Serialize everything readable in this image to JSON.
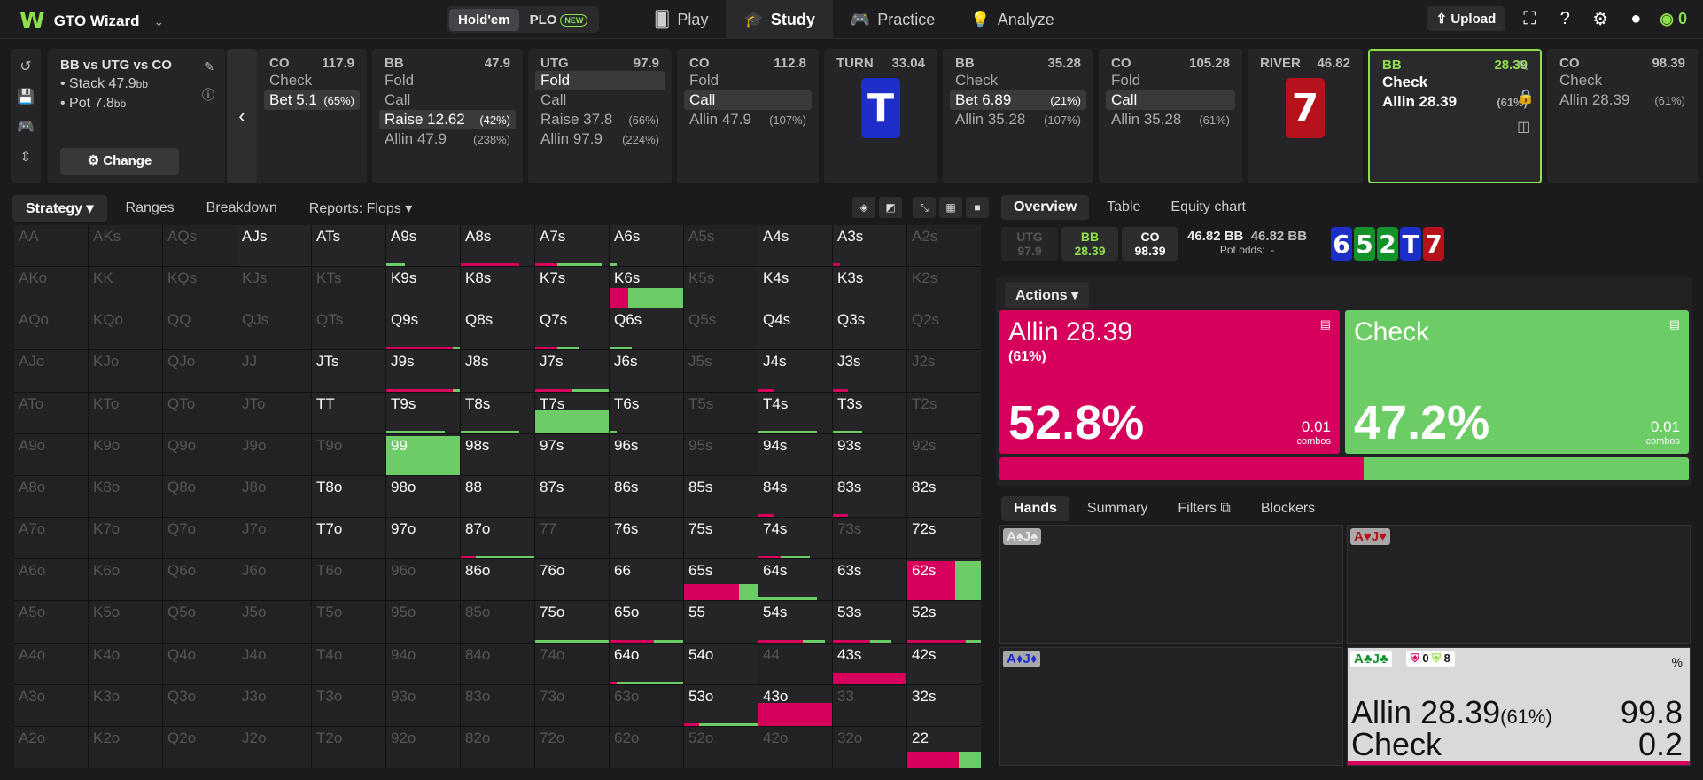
{
  "app": {
    "name": "GTO Wizard"
  },
  "game_toggle": {
    "holdem": "Hold'em",
    "plo": "PLO",
    "plo_badge": "NEW"
  },
  "nav": {
    "play": "Play",
    "study": "Study",
    "practice": "Practice",
    "analyze": "Analyze"
  },
  "topright": {
    "upload": "Upload",
    "credits": "0"
  },
  "spot": {
    "title": "BB vs UTG vs CO",
    "stack_label": "Stack",
    "stack": "47.9",
    "pot_label": "Pot",
    "pot": "7.8",
    "unit": "bb",
    "change": "Change"
  },
  "cards": [
    {
      "pos": "CO",
      "val": "117.9",
      "rows": [
        {
          "a": "Check",
          "p": ""
        },
        {
          "a": "Bet 5.1",
          "p": "(65%)",
          "sel": true
        }
      ]
    },
    {
      "pos": "BB",
      "val": "47.9",
      "rows": [
        {
          "a": "Fold",
          "p": ""
        },
        {
          "a": "Call",
          "p": ""
        },
        {
          "a": "Raise 12.62",
          "p": "(42%)",
          "sel": true
        },
        {
          "a": "Allin 47.9",
          "p": "(238%)"
        }
      ]
    },
    {
      "pos": "UTG",
      "val": "97.9",
      "rows": [
        {
          "a": "Fold",
          "p": "",
          "sel": true
        },
        {
          "a": "Call",
          "p": ""
        },
        {
          "a": "Raise 37.8",
          "p": "(66%)"
        },
        {
          "a": "Allin 97.9",
          "p": "(224%)"
        }
      ]
    },
    {
      "pos": "CO",
      "val": "112.8",
      "rows": [
        {
          "a": "Fold",
          "p": ""
        },
        {
          "a": "Call",
          "p": "",
          "sel": true
        },
        {
          "a": "Allin 47.9",
          "p": "(107%)"
        }
      ]
    },
    {
      "pos": "TURN",
      "val": "33.04",
      "card": "T",
      "color": "#1e2ec9"
    },
    {
      "pos": "BB",
      "val": "35.28",
      "rows": [
        {
          "a": "Check",
          "p": ""
        },
        {
          "a": "Bet 6.89",
          "p": "(21%)",
          "sel": true
        },
        {
          "a": "Allin 35.28",
          "p": "(107%)"
        }
      ]
    },
    {
      "pos": "CO",
      "val": "105.28",
      "rows": [
        {
          "a": "Fold",
          "p": ""
        },
        {
          "a": "Call",
          "p": "",
          "sel": true
        },
        {
          "a": "Allin 35.28",
          "p": "(61%)"
        }
      ]
    },
    {
      "pos": "RIVER",
      "val": "46.82",
      "card": "7",
      "color": "#b5121b"
    },
    {
      "pos": "BB",
      "val": "28.39",
      "rows": [
        {
          "a": "Check",
          "p": ""
        },
        {
          "a": "Allin 28.39",
          "p": "(61%)"
        }
      ],
      "active": true
    },
    {
      "pos": "CO",
      "val": "98.39",
      "rows": [
        {
          "a": "Check",
          "p": ""
        },
        {
          "a": "Allin 28.39",
          "p": "(61%)"
        }
      ]
    }
  ],
  "strategy_tabs": [
    "Strategy",
    "Ranges",
    "Breakdown",
    "Reports: Flops"
  ],
  "matrix": [
    [
      "AA",
      "AKs",
      "AQs",
      "AJs",
      "ATs",
      "A9s",
      "A8s",
      "A7s",
      "A6s",
      "A5s",
      "A4s",
      "A3s",
      "A2s"
    ],
    [
      "AKo",
      "KK",
      "KQs",
      "KJs",
      "KTs",
      "K9s",
      "K8s",
      "K7s",
      "K6s",
      "K5s",
      "K4s",
      "K3s",
      "K2s"
    ],
    [
      "AQo",
      "KQo",
      "QQ",
      "QJs",
      "QTs",
      "Q9s",
      "Q8s",
      "Q7s",
      "Q6s",
      "Q5s",
      "Q4s",
      "Q3s",
      "Q2s"
    ],
    [
      "AJo",
      "KJo",
      "QJo",
      "JJ",
      "JTs",
      "J9s",
      "J8s",
      "J7s",
      "J6s",
      "J5s",
      "J4s",
      "J3s",
      "J2s"
    ],
    [
      "ATo",
      "KTo",
      "QTo",
      "JTo",
      "TT",
      "T9s",
      "T8s",
      "T7s",
      "T6s",
      "T5s",
      "T4s",
      "T3s",
      "T2s"
    ],
    [
      "A9o",
      "K9o",
      "Q9o",
      "J9o",
      "T9o",
      "99",
      "98s",
      "97s",
      "96s",
      "95s",
      "94s",
      "93s",
      "92s"
    ],
    [
      "A8o",
      "K8o",
      "Q8o",
      "J8o",
      "T8o",
      "98o",
      "88",
      "87s",
      "86s",
      "85s",
      "84s",
      "83s",
      "82s"
    ],
    [
      "A7o",
      "K7o",
      "Q7o",
      "J7o",
      "T7o",
      "97o",
      "87o",
      "77",
      "76s",
      "75s",
      "74s",
      "73s",
      "72s"
    ],
    [
      "A6o",
      "K6o",
      "Q6o",
      "J6o",
      "T6o",
      "96o",
      "86o",
      "76o",
      "66",
      "65s",
      "64s",
      "63s",
      "62s"
    ],
    [
      "A5o",
      "K5o",
      "Q5o",
      "J5o",
      "T5o",
      "95o",
      "85o",
      "75o",
      "65o",
      "55",
      "54s",
      "53s",
      "52s"
    ],
    [
      "A4o",
      "K4o",
      "Q4o",
      "J4o",
      "T4o",
      "94o",
      "84o",
      "74o",
      "64o",
      "54o",
      "44",
      "43s",
      "42s"
    ],
    [
      "A3o",
      "K3o",
      "Q3o",
      "J3o",
      "T3o",
      "93o",
      "83o",
      "73o",
      "63o",
      "53o",
      "43o",
      "33",
      "32s"
    ],
    [
      "A2o",
      "K2o",
      "Q2o",
      "J2o",
      "T2o",
      "92o",
      "82o",
      "72o",
      "62o",
      "52o",
      "42o",
      "32o",
      "22"
    ]
  ],
  "right_tabs": [
    "Overview",
    "Table",
    "Equity chart"
  ],
  "stacks": [
    {
      "pos": "UTG",
      "v": "97.9"
    },
    {
      "pos": "BB",
      "v": "28.39"
    },
    {
      "pos": "CO",
      "v": "98.39"
    }
  ],
  "pot_info": {
    "pot": "46.82 BB",
    "pot2": "46.82 BB",
    "odds_label": "Pot odds:",
    "odds": "-"
  },
  "board": [
    {
      "r": "6",
      "c": "#1e2ec9"
    },
    {
      "r": "5",
      "c": "#14912b"
    },
    {
      "r": "2",
      "c": "#14912b"
    },
    {
      "r": "T",
      "c": "#1e2ec9"
    },
    {
      "r": "7",
      "c": "#b5121b"
    }
  ],
  "actions_label": "Actions",
  "actions": [
    {
      "name": "Allin 28.39",
      "pct": "(61%)",
      "freq": "52.8%",
      "freq_value": 52.8,
      "combos": "0.01",
      "combos_label": "combos",
      "color": "#d6005c"
    },
    {
      "name": "Check",
      "pct": "",
      "freq": "47.2%",
      "freq_value": 47.2,
      "combos": "0.01",
      "combos_label": "combos",
      "color": "#6ccc66"
    }
  ],
  "hands_tabs": [
    "Hands",
    "Summary",
    "Filters",
    "Blockers"
  ],
  "hands": [
    {
      "tag": "A♠J♠"
    },
    {
      "tag": "A♥J♥"
    },
    {
      "tag": "A♦J♦"
    },
    {
      "tag": "A♣J♣",
      "blk_red": "0",
      "blk_green": "8",
      "pct": "%",
      "r1": "Allin 28.39",
      "r1p": "(61%)",
      "r1v": "99.8",
      "r2": "Check",
      "r2v": "0.2"
    }
  ],
  "colors": {
    "accent": "#8ee04a",
    "allin": "#d6005c",
    "check": "#6ccc66"
  }
}
